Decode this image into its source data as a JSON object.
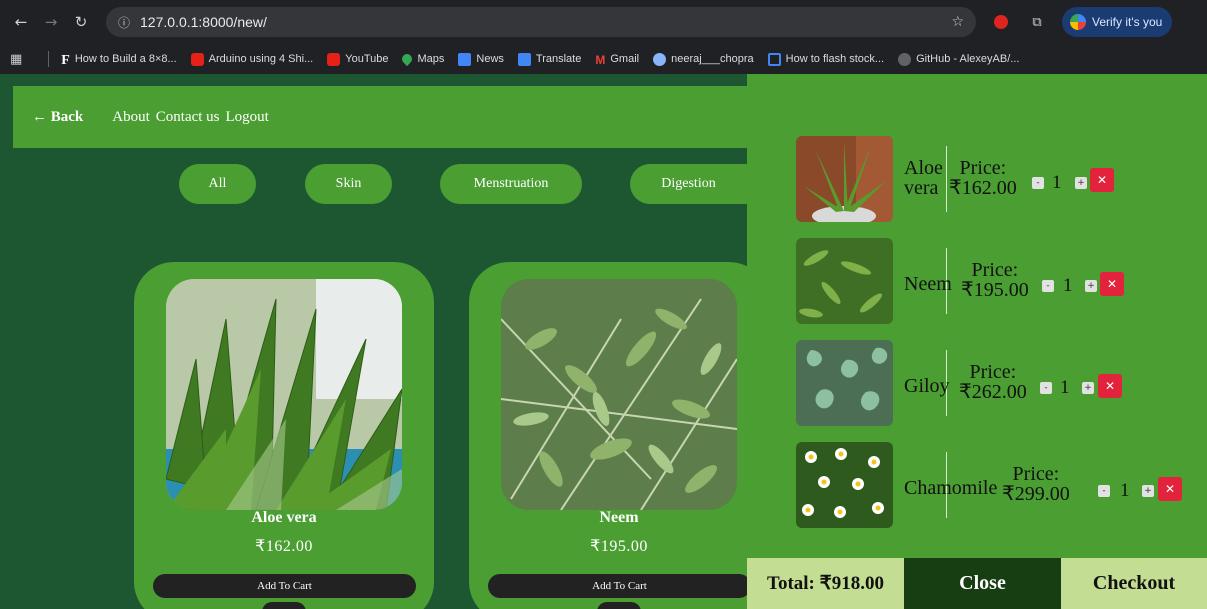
{
  "browser": {
    "url": "127.0.0.1:8000/new/",
    "verify_label": "Verify it's you",
    "bookmarks": [
      {
        "label": "How to Build a 8×8...",
        "icon": "f-logo-icon"
      },
      {
        "label": "Arduino using 4 Shi...",
        "icon": "youtube-icon"
      },
      {
        "label": "YouTube",
        "icon": "youtube-icon"
      },
      {
        "label": "Maps",
        "icon": "maps-icon"
      },
      {
        "label": "News",
        "icon": "news-icon"
      },
      {
        "label": "Translate",
        "icon": "translate-icon"
      },
      {
        "label": "Gmail",
        "icon": "gmail-icon"
      },
      {
        "label": "neeraj___chopra",
        "icon": "globe-icon"
      },
      {
        "label": "How to flash stock...",
        "icon": "phone-icon"
      },
      {
        "label": "GitHub - AlexeyAB/...",
        "icon": "github-icon"
      }
    ]
  },
  "header": {
    "back_label": "← Back",
    "links": [
      "About",
      "Contact us",
      "Logout"
    ]
  },
  "filters": [
    "All",
    "Skin",
    "Menstruation",
    "Digestion"
  ],
  "products": [
    {
      "name": "Aloe vera",
      "price": "₹162.00",
      "button": "Add To Cart"
    },
    {
      "name": "Neem",
      "price": "₹195.00",
      "button": "Add To Cart"
    }
  ],
  "cart": {
    "items": [
      {
        "name": "Aloe vera",
        "name_lines": [
          "Aloe",
          "vera"
        ],
        "price_label": "Price:",
        "price": "₹162.00",
        "qty": "1"
      },
      {
        "name": "Neem",
        "name_lines": [
          "Neem"
        ],
        "price_label": "Price:",
        "price": "₹195.00",
        "qty": "1"
      },
      {
        "name": "Giloy",
        "name_lines": [
          "Giloy"
        ],
        "price_label": "Price:",
        "price": "₹262.00",
        "qty": "1"
      },
      {
        "name": "Chamomile",
        "name_lines": [
          "Chamomile"
        ],
        "price_label": "Price:",
        "price": "₹299.00",
        "qty": "1"
      }
    ],
    "total": "Total: ₹918.00",
    "close_label": "Close",
    "checkout_label": "Checkout",
    "minus_label": "-",
    "plus_label": "+",
    "remove_label": "✕"
  },
  "colors": {
    "page_bg": "#1d5731",
    "panel_green": "#4a9e32",
    "footer_light": "#c3dd93",
    "close_dark": "#173d13",
    "remove_red": "#e2233b"
  }
}
